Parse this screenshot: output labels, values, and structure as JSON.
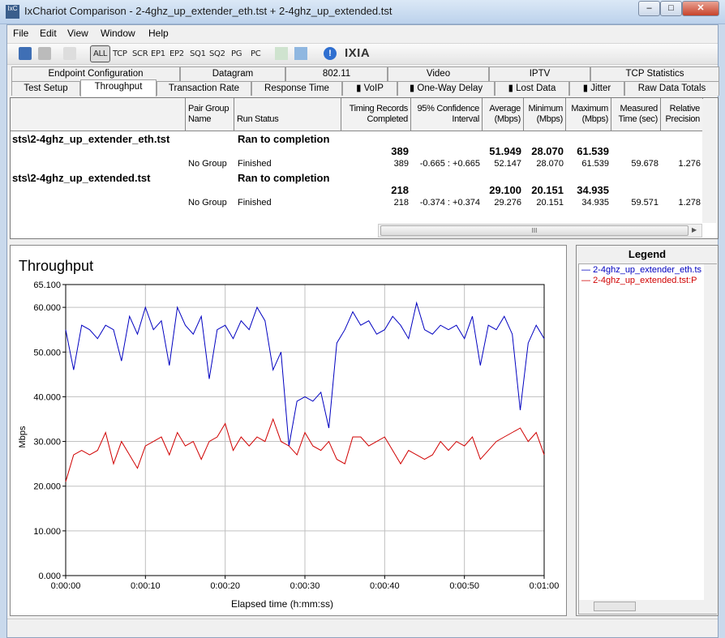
{
  "window": {
    "title": "IxChariot Comparison - 2-4ghz_up_extender_eth.tst + 2-4ghz_up_extended.tst",
    "app_icon": "IxC",
    "minimize": "–",
    "maximize": "□",
    "close": "✕"
  },
  "menu": [
    "File",
    "Edit",
    "View",
    "Window",
    "Help"
  ],
  "toolbar": {
    "filters": [
      "ALL",
      "TCP",
      "SCR",
      "EP1",
      "EP2",
      "SQ1",
      "SQ2",
      "PG",
      "PC"
    ],
    "active_filter": "ALL",
    "logo": "IXIA"
  },
  "tabs_row1": [
    "Endpoint Configuration",
    "Datagram",
    "802.11",
    "Video",
    "IPTV",
    "TCP Statistics"
  ],
  "tabs_row2": [
    "Test Setup",
    "Throughput",
    "Transaction Rate",
    "Response Time",
    "VoIP",
    "One-Way Delay",
    "Lost Data",
    "Jitter",
    "Raw Data Totals"
  ],
  "active_tab": "Throughput",
  "table": {
    "headers": [
      "",
      "Pair Group Name",
      "Run Status",
      "Timing Records Completed",
      "95% Confidence Interval",
      "Average (Mbps)",
      "Minimum (Mbps)",
      "Maximum (Mbps)",
      "Measured Time (sec)",
      "Relative Precision"
    ],
    "tests": [
      {
        "file": "sts\\2-4ghz_up_extender_eth.tst",
        "status": "Ran to completion",
        "summary": {
          "records": "389",
          "average": "51.949",
          "minimum": "28.070",
          "maximum": "61.539"
        },
        "pair": {
          "group": "No Group",
          "status": "Finished",
          "records": "389",
          "ci": "-0.665 : +0.665",
          "average": "52.147",
          "minimum": "28.070",
          "maximum": "61.539",
          "time": "59.678",
          "precision": "1.276"
        }
      },
      {
        "file": "sts\\2-4ghz_up_extended.tst",
        "status": "Ran to completion",
        "summary": {
          "records": "218",
          "average": "29.100",
          "minimum": "20.151",
          "maximum": "34.935"
        },
        "pair": {
          "group": "No Group",
          "status": "Finished",
          "records": "218",
          "ci": "-0.374 : +0.374",
          "average": "29.276",
          "minimum": "20.151",
          "maximum": "34.935",
          "time": "59.571",
          "precision": "1.278"
        }
      }
    ],
    "hscroll_grip": "III"
  },
  "legend": {
    "title": "Legend",
    "entries": [
      {
        "label": "2-4ghz_up_extender_eth.ts",
        "color": "#0000c0"
      },
      {
        "label": "2-4ghz_up_extended.tst:P",
        "color": "#d00000"
      }
    ]
  },
  "chart_data": {
    "type": "line",
    "title": "Throughput",
    "xlabel": "Elapsed time (h:mm:ss)",
    "ylabel": "Mbps",
    "xlim": [
      0,
      60
    ],
    "ylim": [
      0,
      65.1
    ],
    "yticks": [
      "0.000",
      "10.000",
      "20.000",
      "30.000",
      "40.000",
      "50.000",
      "60.000",
      "65.100"
    ],
    "ytick_values": [
      0,
      10,
      20,
      30,
      40,
      50,
      60,
      65.1
    ],
    "xticks": [
      "0:00:00",
      "0:00:10",
      "0:00:20",
      "0:00:30",
      "0:00:40",
      "0:00:50",
      "0:01:00"
    ],
    "grid": true,
    "x": [
      0,
      1,
      2,
      3,
      4,
      5,
      6,
      7,
      8,
      9,
      10,
      11,
      12,
      13,
      14,
      15,
      16,
      17,
      18,
      19,
      20,
      21,
      22,
      23,
      24,
      25,
      26,
      27,
      28,
      29,
      30,
      31,
      32,
      33,
      34,
      35,
      36,
      37,
      38,
      39,
      40,
      41,
      42,
      43,
      44,
      45,
      46,
      47,
      48,
      49,
      50,
      51,
      52,
      53,
      54,
      55,
      56,
      57,
      58,
      59,
      60
    ],
    "series": [
      {
        "color": "#0000c0",
        "values": [
          55,
          46,
          56,
          55,
          53,
          56,
          55,
          48,
          58,
          54,
          60,
          55,
          57,
          47,
          60,
          56,
          54,
          58,
          44,
          55,
          56,
          53,
          57,
          55,
          60,
          57,
          46,
          50,
          29,
          39,
          40,
          39,
          41,
          33,
          52,
          55,
          59,
          56,
          57,
          54,
          55,
          58,
          56,
          53,
          61,
          55,
          54,
          56,
          55,
          56,
          53,
          58,
          47,
          56,
          55,
          58,
          54,
          37,
          52,
          56,
          53
        ]
      },
      {
        "color": "#d00000",
        "values": [
          21,
          27,
          28,
          27,
          28,
          32,
          25,
          30,
          27,
          24,
          29,
          30,
          31,
          27,
          32,
          29,
          30,
          26,
          30,
          31,
          34,
          28,
          31,
          29,
          31,
          30,
          35,
          30,
          29,
          27,
          32,
          29,
          28,
          30,
          26,
          25,
          31,
          31,
          29,
          30,
          31,
          28,
          25,
          28,
          27,
          26,
          27,
          30,
          28,
          30,
          29,
          31,
          26,
          28,
          30,
          31,
          32,
          33,
          30,
          32,
          27
        ]
      }
    ]
  }
}
